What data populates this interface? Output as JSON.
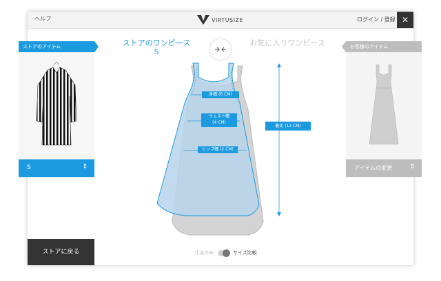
{
  "header": {
    "help_label": "ヘルプ",
    "brand": "VIRTUSIZE",
    "login_label": "ログイン / 登録",
    "close_icon": "close-icon"
  },
  "titles": {
    "store_item": "ストアのワンピース",
    "store_size": "S",
    "favorite_item": "お気に入りワンピース"
  },
  "left_panel": {
    "ribbon": "ストアのアイテム",
    "selected_size": "S",
    "image_icon": "striped-dress-image"
  },
  "right_panel": {
    "ribbon": "お客様のアイテム",
    "change_label": "アイテムの変更",
    "image_icon": "gray-dress-image"
  },
  "measurements": {
    "bust": "身幅 (6 CM)",
    "waist": "ウェスト幅\n(4 CM)",
    "waist_line1": "ウェスト幅",
    "waist_line2": "(4 CM)",
    "hip": "ヒップ幅 (2 CM)",
    "length": "着丈 (12 CM)"
  },
  "footer": {
    "back_label": "ストアに戻る",
    "toggle_off_label": "寸法のみ",
    "toggle_on_label": "サイズ比較"
  },
  "colors": {
    "accent": "#1c9ae0",
    "dark": "#333333",
    "muted": "#bdbdbd"
  }
}
